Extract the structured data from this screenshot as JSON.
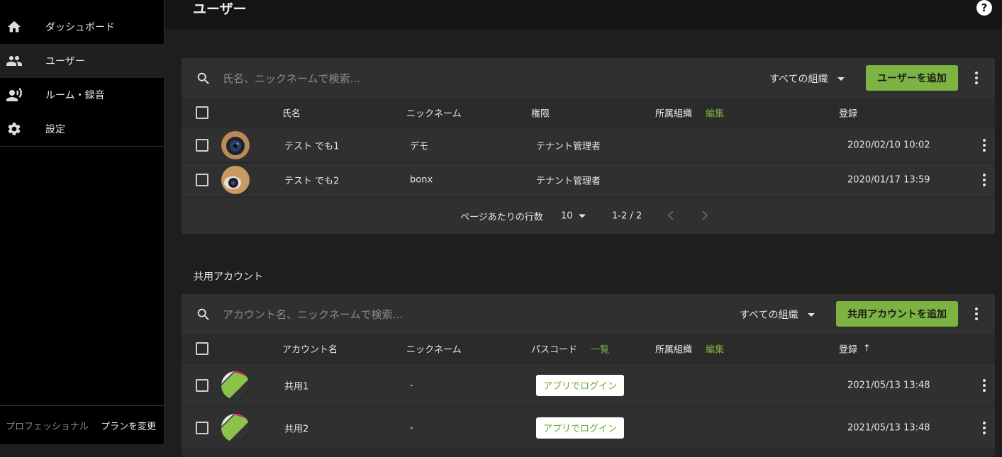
{
  "sidebar": {
    "items": [
      {
        "label": "ダッシュボード",
        "icon": "home-icon"
      },
      {
        "label": "ユーザー",
        "icon": "people-icon"
      },
      {
        "label": "ルーム・録音",
        "icon": "voice-icon"
      },
      {
        "label": "設定",
        "icon": "gear-icon"
      }
    ],
    "plan_label": "プロフェッショナル",
    "plan_change": "プランを変更"
  },
  "header": {
    "title": "ユーザー",
    "help": "?"
  },
  "users": {
    "search_placeholder": "氏名、ニックネームで検索...",
    "org_filter": "すべての組織",
    "add_label": "ユーザーを追加",
    "columns": {
      "name": "氏名",
      "nickname": "ニックネーム",
      "role": "権限",
      "org": "所属組織",
      "org_edit": "編集",
      "registered": "登録"
    },
    "rows": [
      {
        "name": "テスト でも1",
        "nickname": "デモ",
        "role": "テナント管理者",
        "registered": "2020/02/10 10:02"
      },
      {
        "name": "テスト でも2",
        "nickname": "bonx",
        "role": "テナント管理者",
        "registered": "2020/01/17 13:59"
      }
    ],
    "pager": {
      "rows_label": "ページあたりの行数",
      "rows_value": "10",
      "range": "1-2 / 2"
    }
  },
  "shared": {
    "section_title": "共用アカウント",
    "search_placeholder": "アカウント名、ニックネームで検索...",
    "org_filter": "すべての組織",
    "add_label": "共用アカウントを追加",
    "columns": {
      "account": "アカウント名",
      "nickname": "ニックネーム",
      "passcode": "パスコード",
      "passcode_list": "一覧",
      "org": "所属組織",
      "org_edit": "編集",
      "registered": "登録",
      "sort": "↑"
    },
    "rows": [
      {
        "name": "共用1",
        "nickname": "-",
        "login_label": "アプリでログイン",
        "registered": "2021/05/13 13:48"
      },
      {
        "name": "共用2",
        "nickname": "-",
        "login_label": "アプリでログイン",
        "registered": "2021/05/13 13:48"
      }
    ]
  },
  "colors": {
    "accent": "#7cb342",
    "sidebar_bg": "#000000",
    "card_bg": "#303030"
  }
}
